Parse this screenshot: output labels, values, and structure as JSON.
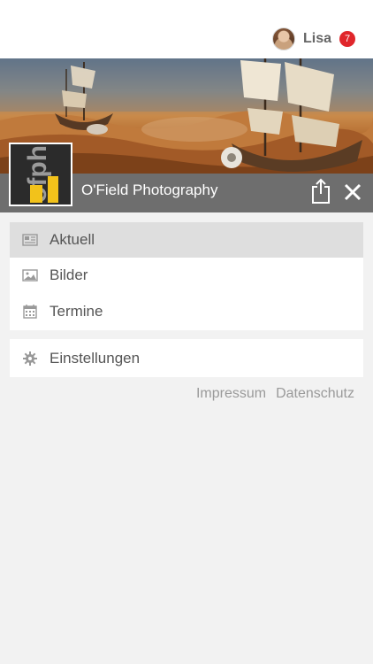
{
  "header": {
    "user_name": "Lisa",
    "notification_count": "7",
    "avatar_icon": "user-avatar"
  },
  "banner": {
    "title": "O'Field Photography",
    "logo_text": "ofph"
  },
  "menu": {
    "items": [
      {
        "label": "Aktuell",
        "icon": "newspaper-icon",
        "active": true
      },
      {
        "label": "Bilder",
        "icon": "image-icon",
        "active": false
      },
      {
        "label": "Termine",
        "icon": "calendar-icon",
        "active": false
      }
    ],
    "settings": {
      "label": "Einstellungen",
      "icon": "gear-icon"
    }
  },
  "footer": {
    "impressum": "Impressum",
    "datenschutz": "Datenschutz"
  },
  "colors": {
    "badge": "#e0262b",
    "titlebar": "#6e6e6e",
    "active_item": "#dedede",
    "logo_accent": "#f2c21b"
  }
}
